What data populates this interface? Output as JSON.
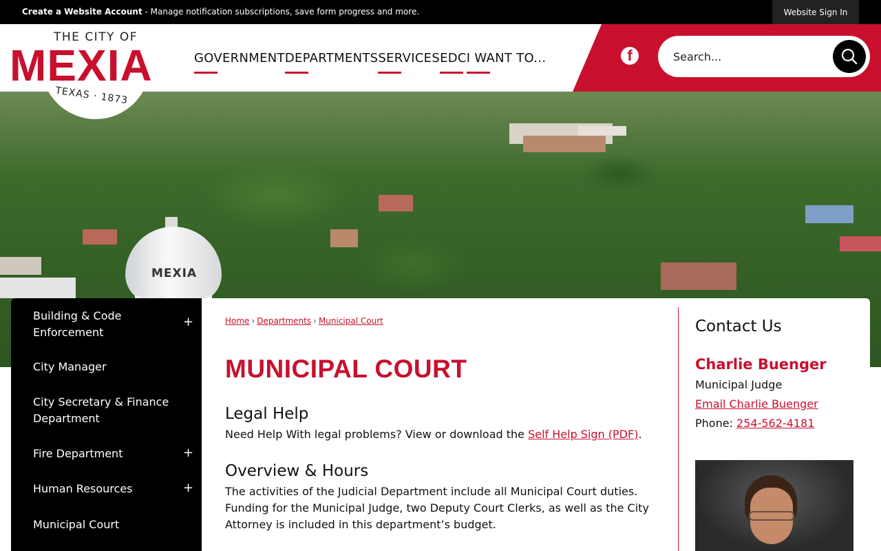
{
  "topbar": {
    "account_strong": "Create a Website Account",
    "account_rest": " - Manage notification subscriptions, save form progress and more.",
    "signin": "Website Sign In"
  },
  "logo": {
    "city_of": "THE CITY OF",
    "name": "MEXIA",
    "tagline": "TEXAS · 1873"
  },
  "nav": [
    {
      "label": "GOVERNMENT"
    },
    {
      "label": "DEPARTMENTS"
    },
    {
      "label": "SERVICES"
    },
    {
      "label": "EDC"
    },
    {
      "label": "I WANT TO..."
    }
  ],
  "social": {
    "facebook": "f",
    "icon": "facebook-icon"
  },
  "search": {
    "placeholder": "Search..."
  },
  "hero": {
    "tower_text": "MEXIA"
  },
  "sidenav": [
    {
      "label": "Building & Code Enforcement",
      "expandable": true
    },
    {
      "label": "City Manager",
      "expandable": false
    },
    {
      "label": "City Secretary & Finance Department",
      "expandable": false
    },
    {
      "label": "Fire Department",
      "expandable": true
    },
    {
      "label": "Human Resources",
      "expandable": true
    },
    {
      "label": "Municipal Court",
      "expandable": false
    }
  ],
  "sidenav_plus": "+",
  "breadcrumb": [
    "Home",
    "Departments",
    "Municipal Court"
  ],
  "breadcrumb_sep": "›",
  "page_title": "MUNICIPAL COURT",
  "sections": {
    "legal_help": {
      "heading": "Legal Help",
      "text_before": "Need Help With legal problems? View or download the ",
      "link": "Self Help Sign (PDF)",
      "text_after": "."
    },
    "overview": {
      "heading": "Overview & Hours",
      "text": "The activities of the Judicial Department include all Municipal Court duties. Funding for the Municipal Judge, two Deputy Court Clerks, as well as the City Attorney is included in this department’s budget."
    }
  },
  "contact": {
    "heading": "Contact Us",
    "name": "Charlie Buenger",
    "role": "Municipal Judge",
    "email_label": "Email Charlie Buenger",
    "phone_label": "Phone: ",
    "phone": "254-562-4181"
  },
  "colors": {
    "brand_red": "#c8102e",
    "black": "#000000"
  }
}
